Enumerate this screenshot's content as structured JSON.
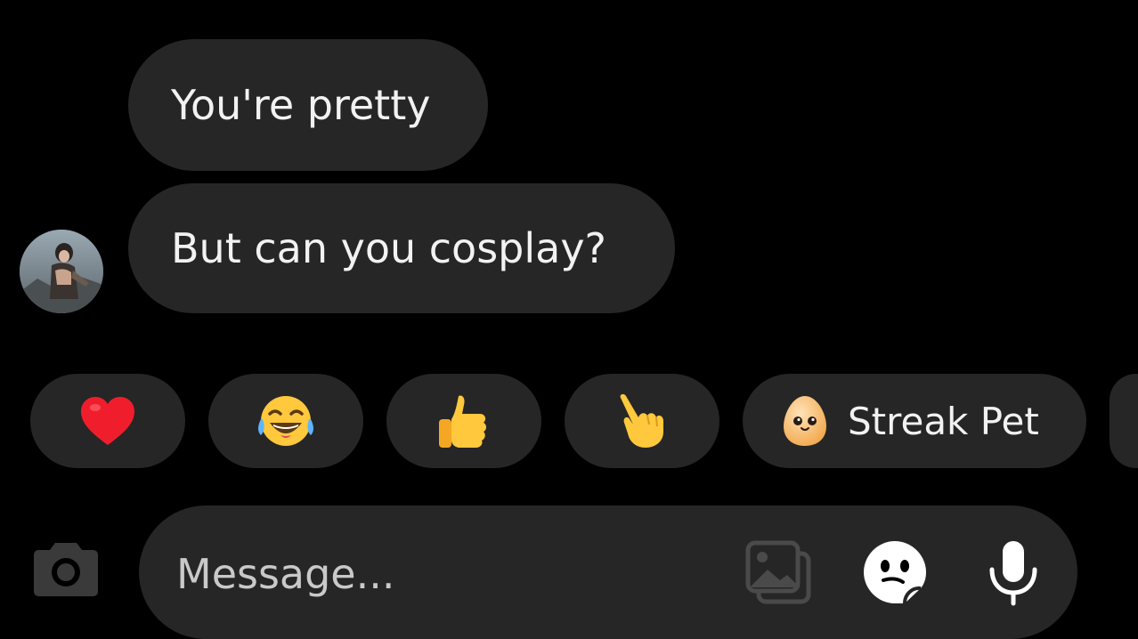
{
  "messages": [
    {
      "text": "You're pretty"
    },
    {
      "text": "But can you cosplay?"
    }
  ],
  "reactions": [
    {
      "icon": "red-heart-icon"
    },
    {
      "icon": "tears-of-joy-icon"
    },
    {
      "icon": "thumbs-up-icon"
    },
    {
      "icon": "pointing-hand-icon"
    },
    {
      "icon": "egg-pet-icon",
      "label": "Streak Pet"
    }
  ],
  "composer": {
    "placeholder": "Message...",
    "icons": [
      "camera-icon",
      "gallery-icon",
      "sticker-icon",
      "microphone-icon"
    ]
  },
  "colors": {
    "background": "#000000",
    "bubble": "#262626",
    "text": "#f2f2f2",
    "placeholder": "#c9c9c9"
  }
}
